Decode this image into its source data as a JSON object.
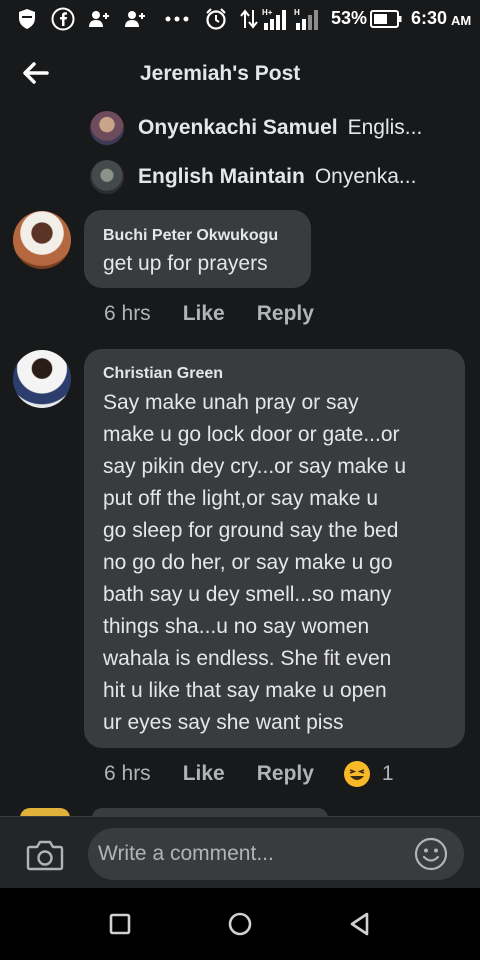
{
  "status_bar": {
    "battery_percent": "53%",
    "time": "6:30",
    "ampm": "AM",
    "icons": [
      "shield-icon",
      "facebook-icon",
      "person-add-icon",
      "person-add-icon",
      "more-dots-icon",
      "alarm-icon",
      "data-arrows-icon",
      "signal-h-plus-icon",
      "signal-h-icon",
      "battery-icon"
    ]
  },
  "header": {
    "title": "Jeremiah's Post"
  },
  "reply_previews": [
    {
      "name": "Onyenkachi Samuel",
      "text": "Englis..."
    },
    {
      "name": "English Maintain",
      "text": "Onyenka..."
    }
  ],
  "comments": [
    {
      "author": "Buchi Peter Okwukogu",
      "text": "get up for prayers",
      "time": "6 hrs",
      "like": "Like",
      "reply": "Reply"
    },
    {
      "author": "Christian Green",
      "lines": [
        "Say make unah pray or say",
        "make u go lock door or gate...or",
        "say pikin dey cry...or say make u",
        "put off the light,or say make u",
        "go sleep for ground say the bed",
        "no go do her, or say make u go",
        "bath say u dey smell...so many",
        "things sha...u no say women",
        "wahala is endless. She fit even",
        "hit u like that say make u open",
        "ur eyes say she want piss"
      ],
      "time": "6 hrs",
      "like": "Like",
      "reply": "Reply",
      "reaction": "laughing-emoji",
      "reaction_count": "1"
    }
  ],
  "composer": {
    "placeholder": "Write a comment..."
  },
  "colors": {
    "background": "#18191a",
    "bubble": "#3a3b3c",
    "composer": "#242526",
    "text": "#e4e6eb",
    "secondary_text": "#b0b3b8",
    "reaction": "#f7b928"
  }
}
